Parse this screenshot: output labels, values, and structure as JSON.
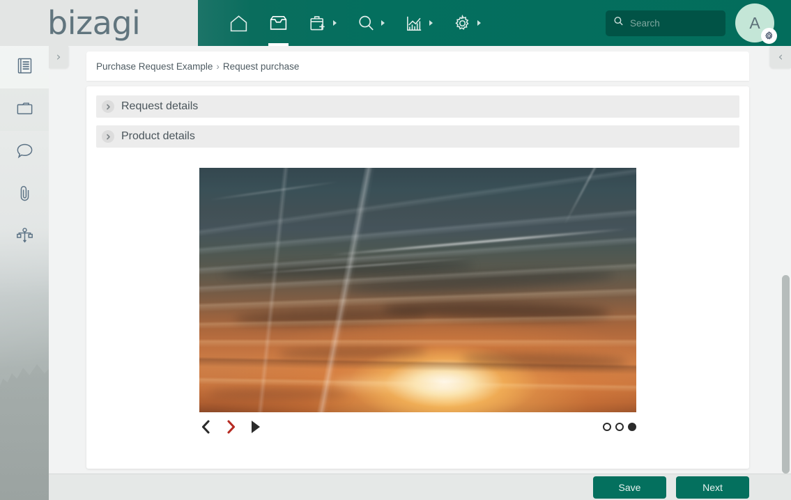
{
  "brand": {
    "logo_text": "bizagi",
    "teal": "#04705e",
    "logo_color": "#61757e"
  },
  "topnav": {
    "items": [
      {
        "label": "Home",
        "icon": "home-icon",
        "has_caret": false,
        "active": false
      },
      {
        "label": "Inbox",
        "icon": "inbox-icon",
        "has_caret": false,
        "active": true
      },
      {
        "label": "New case",
        "icon": "briefcase-plus-icon",
        "has_caret": true,
        "active": false
      },
      {
        "label": "Queries",
        "icon": "search-icon",
        "has_caret": true,
        "active": false
      },
      {
        "label": "Analytics",
        "icon": "chart-icon",
        "has_caret": true,
        "active": false
      },
      {
        "label": "Admin",
        "icon": "gear-icon",
        "has_caret": true,
        "active": false
      }
    ]
  },
  "search": {
    "placeholder": "Search",
    "value": "",
    "icon": "search-icon"
  },
  "user": {
    "initial": "A",
    "badge_icon": "gear-icon",
    "avatar_color": "#c4e6d7"
  },
  "sidebar": {
    "expand_toggle": "›",
    "items": [
      {
        "name": "sidebar-item-form",
        "icon": "form-list-icon",
        "label": "Form"
      },
      {
        "name": "sidebar-item-documents",
        "icon": "folder-icon",
        "label": "Documents"
      },
      {
        "name": "sidebar-item-comments",
        "icon": "comment-icon",
        "label": "Comments"
      },
      {
        "name": "sidebar-item-attachments",
        "icon": "paperclip-icon",
        "label": "Attachments"
      },
      {
        "name": "sidebar-item-process",
        "icon": "process-diagram-icon",
        "label": "Process"
      }
    ]
  },
  "right_panel": {
    "collapse_toggle": "‹"
  },
  "breadcrumb": {
    "root": "Purchase Request Example",
    "separator": "›",
    "current": "Request purchase"
  },
  "form": {
    "sections": [
      {
        "title": "Request details",
        "chevron": "›",
        "expanded": false
      },
      {
        "title": "Product details",
        "chevron": "›",
        "expanded": false
      }
    ]
  },
  "carousel": {
    "image_alt": "Sunset sky with contrails",
    "controls": {
      "previous": "prev-chevron",
      "next": "next-chevron",
      "play": "play-triangle",
      "next_color": "#b62b22",
      "prev_color": "#2b2b2b"
    },
    "slide_count": 3,
    "active_slide": 3
  },
  "footer": {
    "save_label": "Save",
    "next_label": "Next"
  }
}
